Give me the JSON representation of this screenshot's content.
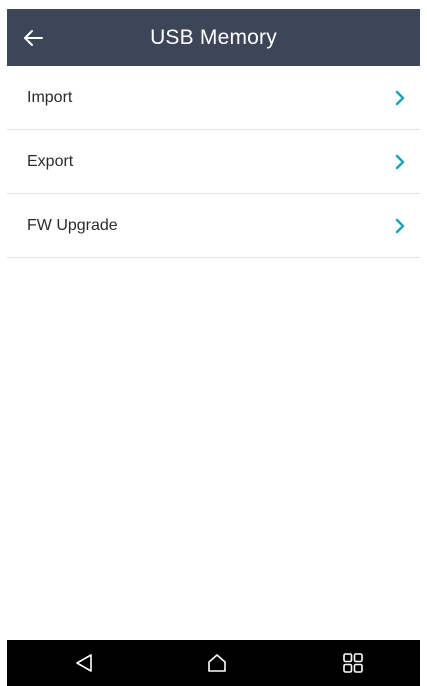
{
  "header": {
    "title": "USB Memory",
    "back_icon": "back-arrow-icon",
    "background": "#3d4659"
  },
  "menu": {
    "items": [
      {
        "label": "Import",
        "icon": "chevron-right-icon"
      },
      {
        "label": "Export",
        "icon": "chevron-right-icon"
      },
      {
        "label": "FW Upgrade",
        "icon": "chevron-right-icon"
      }
    ],
    "accent": "#1fa3be"
  },
  "navbar": {
    "buttons": [
      "nav-back-icon",
      "nav-home-icon",
      "nav-recent-apps-icon"
    ],
    "background": "#000000"
  }
}
